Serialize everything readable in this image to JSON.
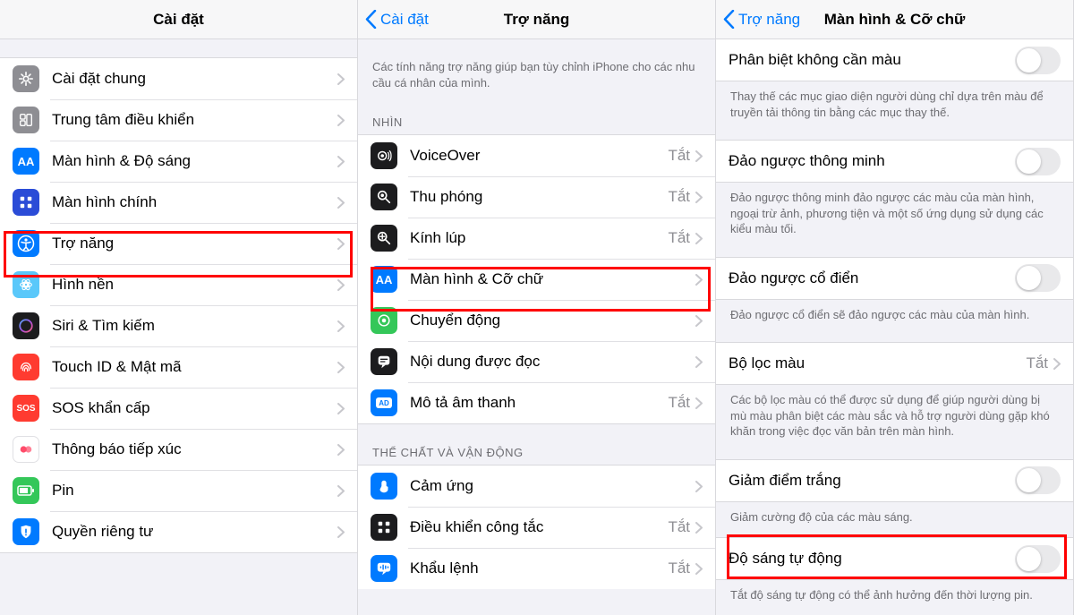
{
  "colors": {
    "accent": "#007aff",
    "gray": "#8e8e93",
    "green": "#34c759",
    "red": "#ff3b30",
    "orange": "#ff9500",
    "pink": "#ff2d55",
    "teal": "#5ac8fa"
  },
  "panel1": {
    "title": "Cài đặt",
    "items": [
      {
        "label": "Cài đặt chung",
        "iconBg": "#8e8e93",
        "iconName": "gear-icon"
      },
      {
        "label": "Trung tâm điều khiển",
        "iconBg": "#8e8e93",
        "iconName": "control-center-icon"
      },
      {
        "label": "Màn hình & Độ sáng",
        "iconBg": "#007aff",
        "iconName": "display-brightness-icon",
        "iconText": "AA"
      },
      {
        "label": "Màn hình chính",
        "iconBg": "#2b4cd7",
        "iconName": "home-screen-icon"
      },
      {
        "label": "Trợ năng",
        "iconBg": "#007aff",
        "iconName": "accessibility-icon"
      },
      {
        "label": "Hình nền",
        "iconBg": "#5ac8fa",
        "iconName": "wallpaper-icon"
      },
      {
        "label": "Siri & Tìm kiếm",
        "iconBg": "#1c1c1e",
        "iconName": "siri-icon"
      },
      {
        "label": "Touch ID & Mật mã",
        "iconBg": "#ff3b30",
        "iconName": "touchid-icon"
      },
      {
        "label": "SOS khẩn cấp",
        "iconBg": "#ff3b30",
        "iconName": "sos-icon",
        "iconText": "SOS"
      },
      {
        "label": "Thông báo tiếp xúc",
        "iconBg": "#ffffff",
        "iconName": "exposure-icon"
      },
      {
        "label": "Pin",
        "iconBg": "#34c759",
        "iconName": "battery-icon"
      },
      {
        "label": "Quyền riêng tư",
        "iconBg": "#007aff",
        "iconName": "privacy-icon"
      }
    ]
  },
  "panel2": {
    "back": "Cài đặt",
    "title": "Trợ năng",
    "intro": "Các tính năng trợ năng giúp bạn tùy chỉnh iPhone cho các nhu cầu cá nhân của mình.",
    "group1_title": "NHÌN",
    "g1": [
      {
        "label": "VoiceOver",
        "value": "Tắt",
        "iconBg": "#1c1c1e",
        "iconName": "voiceover-icon"
      },
      {
        "label": "Thu phóng",
        "value": "Tắt",
        "iconBg": "#1c1c1e",
        "iconName": "zoom-icon"
      },
      {
        "label": "Kính lúp",
        "value": "Tắt",
        "iconBg": "#1c1c1e",
        "iconName": "magnifier-icon"
      },
      {
        "label": "Màn hình & Cỡ chữ",
        "value": "",
        "iconBg": "#007aff",
        "iconName": "display-text-size-icon",
        "iconText": "AA"
      },
      {
        "label": "Chuyển động",
        "value": "",
        "iconBg": "#34c759",
        "iconName": "motion-icon"
      },
      {
        "label": "Nội dung được đọc",
        "value": "",
        "iconBg": "#1c1c1e",
        "iconName": "spoken-content-icon"
      },
      {
        "label": "Mô tả âm thanh",
        "value": "Tắt",
        "iconBg": "#007aff",
        "iconName": "audio-description-icon"
      }
    ],
    "group2_title": "THỂ CHẤT VÀ VẬN ĐỘNG",
    "g2": [
      {
        "label": "Cảm ứng",
        "value": "",
        "iconBg": "#007aff",
        "iconName": "touch-icon"
      },
      {
        "label": "Điều khiển công tắc",
        "value": "Tắt",
        "iconBg": "#1c1c1e",
        "iconName": "switch-control-icon"
      },
      {
        "label": "Khẩu lệnh",
        "value": "Tắt",
        "iconBg": "#007aff",
        "iconName": "voice-control-icon"
      }
    ]
  },
  "panel3": {
    "back": "Trợ năng",
    "title": "Màn hình & Cỡ chữ",
    "r1": {
      "label": "Phân biệt không cần màu",
      "footer": "Thay thế các mục giao diện người dùng chỉ dựa trên màu để truyền tải thông tin bằng các mục thay thế."
    },
    "r2": {
      "label": "Đảo ngược thông minh",
      "footer": "Đảo ngược thông minh đảo ngược các màu của màn hình, ngoại trừ ảnh, phương tiện và một số ứng dụng sử dụng các kiểu màu tối."
    },
    "r3": {
      "label": "Đảo ngược cổ điển",
      "footer": "Đảo ngược cổ điển sẽ đảo ngược các màu của màn hình."
    },
    "r4": {
      "label": "Bộ lọc màu",
      "value": "Tắt",
      "footer": "Các bộ lọc màu có thể được sử dụng để giúp người dùng bị mù màu phân biệt các màu sắc và hỗ trợ người dùng gặp khó khăn trong việc đọc văn bản trên màn hình."
    },
    "r5": {
      "label": "Giảm điểm trắng",
      "footer": "Giảm cường độ của các màu sáng."
    },
    "r6": {
      "label": "Độ sáng tự động",
      "footer": "Tắt độ sáng tự động có thể ảnh hưởng đến thời lượng pin."
    }
  }
}
